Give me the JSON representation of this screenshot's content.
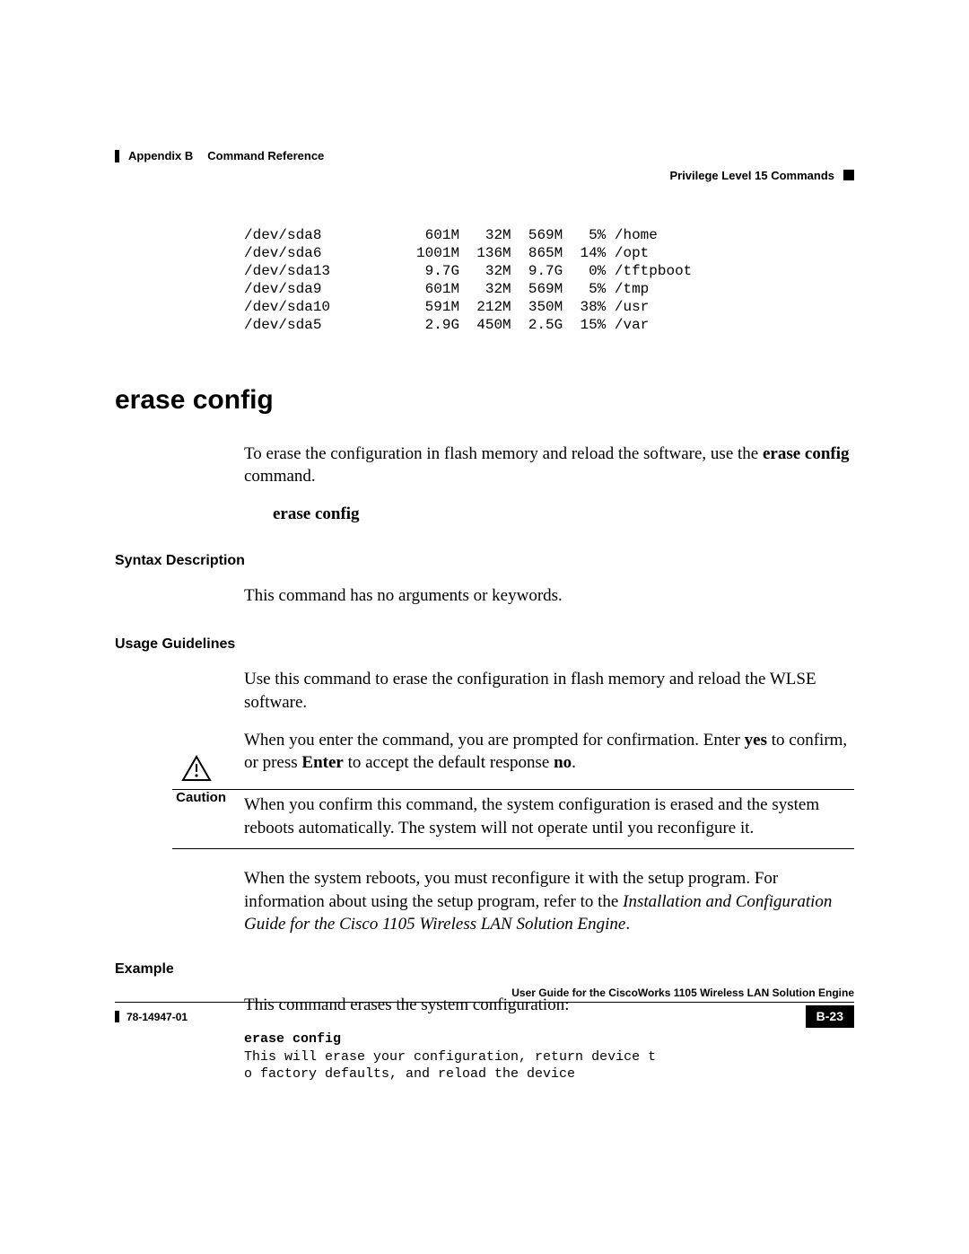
{
  "header": {
    "appendix": "Appendix B",
    "chapter": "Command Reference",
    "section": "Privilege Level 15 Commands"
  },
  "disk_table_rows": [
    {
      "dev": "/dev/sda8",
      "size": "601M",
      "used": "32M",
      "avail": "569M",
      "pct": "5%",
      "mount": "/home"
    },
    {
      "dev": "/dev/sda6",
      "size": "1001M",
      "used": "136M",
      "avail": "865M",
      "pct": "14%",
      "mount": "/opt"
    },
    {
      "dev": "/dev/sda13",
      "size": "9.7G",
      "used": "32M",
      "avail": "9.7G",
      "pct": "0%",
      "mount": "/tftpboot"
    },
    {
      "dev": "/dev/sda9",
      "size": "601M",
      "used": "32M",
      "avail": "569M",
      "pct": "5%",
      "mount": "/tmp"
    },
    {
      "dev": "/dev/sda10",
      "size": "591M",
      "used": "212M",
      "avail": "350M",
      "pct": "38%",
      "mount": "/usr"
    },
    {
      "dev": "/dev/sda5",
      "size": "2.9G",
      "used": "450M",
      "avail": "2.5G",
      "pct": "15%",
      "mount": "/var"
    }
  ],
  "command": {
    "title": "erase config",
    "intro_pre": "To erase the configuration in flash memory and reload the software, use the ",
    "intro_bold": "erase config",
    "intro_post": " command.",
    "syntax_line": "erase config",
    "syntax_head": "Syntax Description",
    "syntax_text": "This command has no arguments or keywords.",
    "usage_head": "Usage Guidelines",
    "usage_p1": "Use this command to erase the configuration in flash memory and reload the WLSE software.",
    "usage_p2_pre": "When you enter the command, you are prompted for confirmation. Enter ",
    "usage_p2_b1": "yes",
    "usage_p2_mid": " to confirm, or press ",
    "usage_p2_b2": "Enter",
    "usage_p2_mid2": " to accept the default response ",
    "usage_p2_b3": "no",
    "usage_p2_post": ".",
    "caution_label": "Caution",
    "caution_text": "When you confirm this command, the system configuration is erased and the system reboots automatically. The system will not operate until you reconfigure it.",
    "after_caution_pre": "When the system reboots, you must reconfigure it with the setup program. For information about using the setup program, refer to the ",
    "after_caution_italic": "Installation and Configuration Guide for the Cisco 1105 Wireless LAN Solution Engine",
    "after_caution_post": ".",
    "example_head": "Example",
    "example_intro": "This command erases the system configuration:",
    "example_code_bold": "erase config",
    "example_code_l1": "This will erase your configuration, return device t",
    "example_code_l2": "o factory defaults, and reload the device"
  },
  "footer": {
    "guide": "User Guide for the CiscoWorks 1105 Wireless LAN Solution Engine",
    "pub": "78-14947-01",
    "page": "B-23"
  }
}
